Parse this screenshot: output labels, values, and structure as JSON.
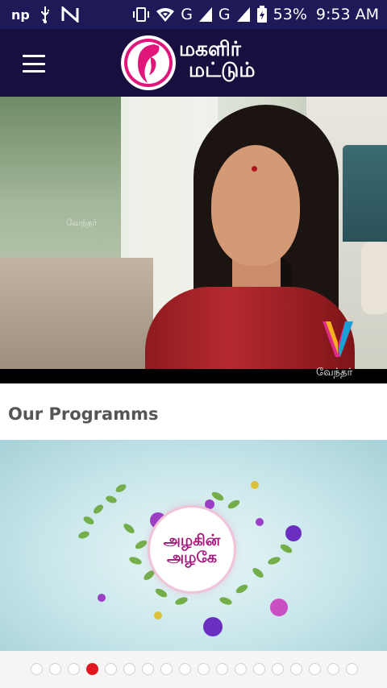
{
  "status_bar": {
    "left_icons": [
      "np-icon",
      "usb-icon",
      "n-icon"
    ],
    "right_icons": [
      "vibrate-icon",
      "wifi-icon",
      "signal-g-icon",
      "signal-g-icon",
      "battery-icon"
    ],
    "network_1": "G",
    "network_2": "G",
    "battery_percent": "53%",
    "time": "9:53 AM"
  },
  "app_bar": {
    "logo_title_line1": "மகளிர்",
    "logo_title_line2": "மட்டும்",
    "menu_icon": "hamburger-menu-icon"
  },
  "video": {
    "channel_name": "வேந்தர்",
    "watermark": "வேந்தர்"
  },
  "section": {
    "title": "Our Programms"
  },
  "banner": {
    "title_line1": "அழகின்",
    "title_line2": "அழகே"
  },
  "pager": {
    "count": 18,
    "active_index": 3
  },
  "colors": {
    "status_bar": "#1d1a57",
    "app_bar": "#170f3e",
    "accent_pink": "#e0167a",
    "active_dot": "#e0171e"
  }
}
